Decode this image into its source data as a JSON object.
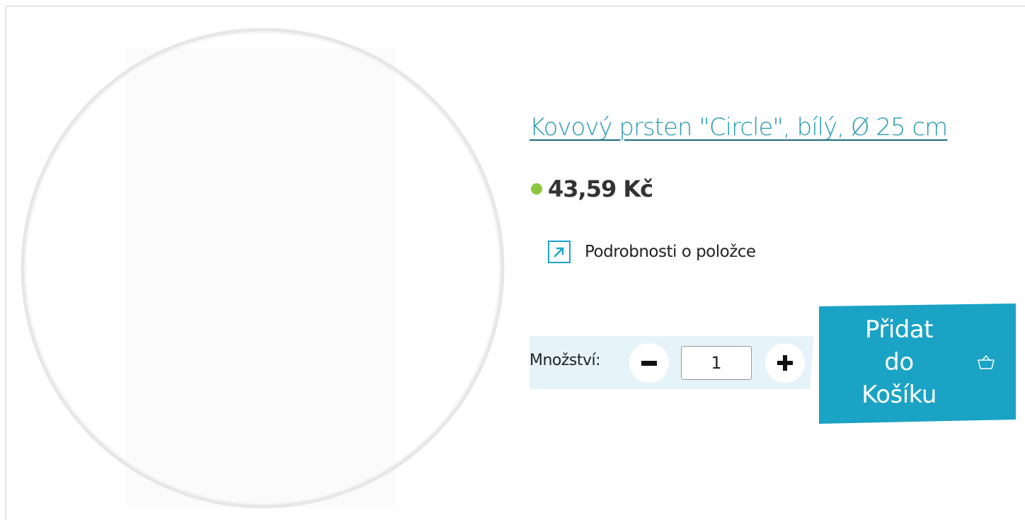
{
  "product": {
    "title": "Kovový prsten \"Circle\", bílý, Ø 25 cm",
    "price": "43,59 Kč",
    "availability_color": "#8cc63f",
    "details_link": {
      "label": "Podrobnosti o položce",
      "icon": "arrow-up-right-icon"
    }
  },
  "purchase": {
    "quantity_label": "Množství:",
    "quantity_value": "1",
    "decrease_icon": "minus-icon",
    "increase_icon": "plus-icon",
    "add_to_cart_lines": [
      "Přidat",
      "do",
      "Košíku"
    ],
    "cart_icon": "basket-icon"
  },
  "colors": {
    "accent": "#1aa3c4",
    "link": "#2a9bb3",
    "qty_bar": "#e6f4f9"
  }
}
